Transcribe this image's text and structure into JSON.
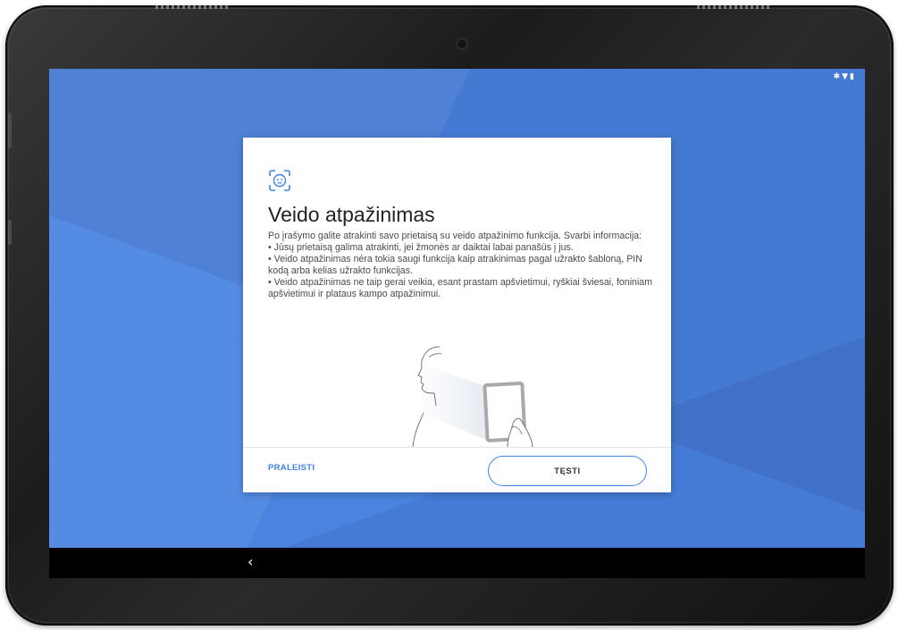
{
  "dialog": {
    "icon": "face-recognition-icon",
    "title": "Veido atpažinimas",
    "paragraphs": [
      "Po įrašymo galite atrakinti savo prietaisą su veido atpažinimo funkcija. Svarbi informacija:",
      "• Jūsų prietaisą galima atrakinti, jei žmonės ar daiktai labai panašūs į jus.",
      "• Veido atpažinimas nėra tokia saugi funkcija kaip atrakinimas pagal užrakto šabloną, PIN kodą arba kelias užrakto funkcijas.",
      "• Veido atpažinimas ne taip gerai veikia, esant prastam apšvietimui, ryškiai šviesai, foniniam apšvietimui ir plataus kampo atpažinimui."
    ],
    "skip_label": "PRALEISTI",
    "test_label": "TĘSTI"
  },
  "status_bar": {
    "icons": [
      "bluetooth-icon",
      "wifi-icon",
      "battery-icon"
    ]
  },
  "nav_bar": {
    "back_label": "‹"
  },
  "colors": {
    "screen_bg": "#4a84e0",
    "accent": "#3f83ea"
  }
}
